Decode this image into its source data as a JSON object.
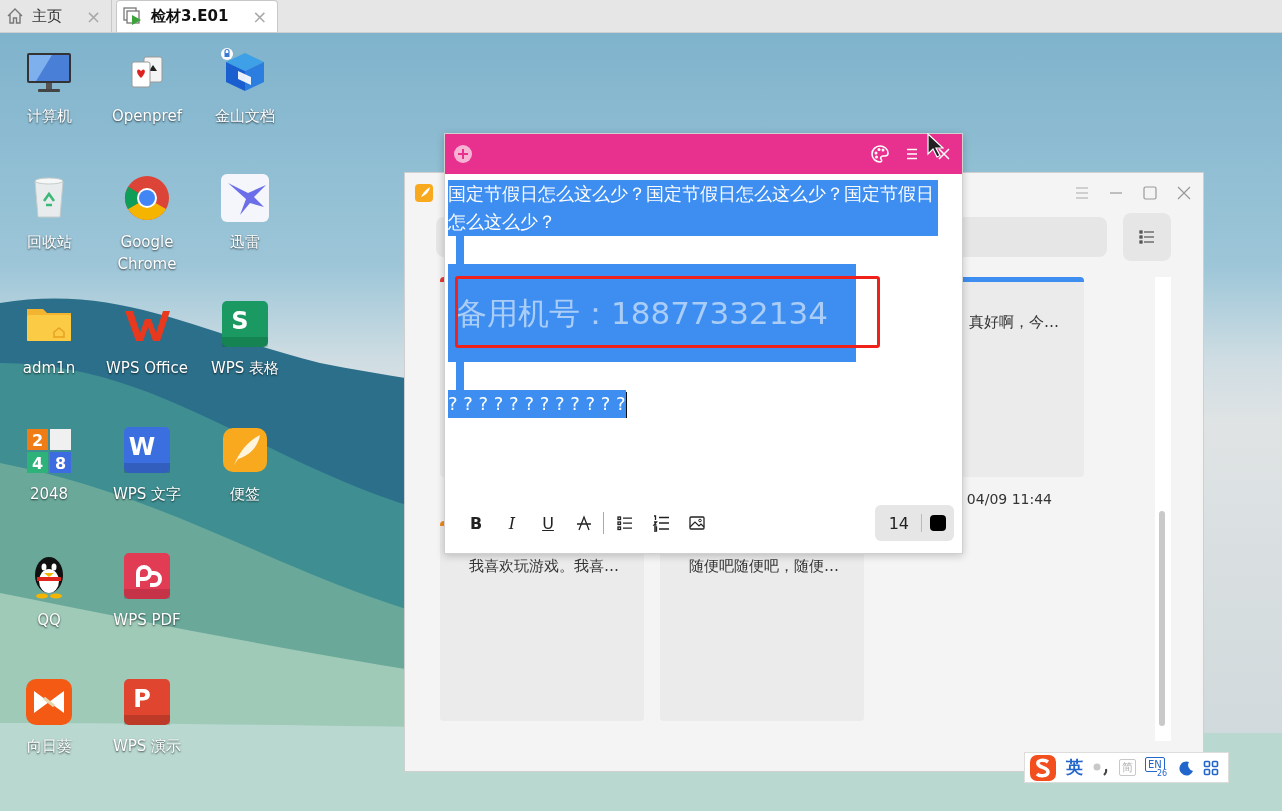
{
  "tabs": [
    {
      "label": "主页",
      "close": "×",
      "selected": false
    },
    {
      "label": "检材3.E01",
      "close": "×",
      "selected": true
    }
  ],
  "desktop_icons": [
    {
      "label": "计算机",
      "kind": "monitor"
    },
    {
      "label": "回收站",
      "kind": "trash"
    },
    {
      "label": "adm1n",
      "kind": "folder"
    },
    {
      "label": "2048",
      "kind": "game2048",
      "glyphs": [
        "2",
        "4",
        "8"
      ]
    },
    {
      "label": "QQ",
      "kind": "penguin"
    },
    {
      "label": "向日葵",
      "kind": "sunflower"
    },
    {
      "label": "Openpref",
      "kind": "cards"
    },
    {
      "label": "Google Chrome",
      "kind": "chrome"
    },
    {
      "label": "WPS Office",
      "kind": "wps"
    },
    {
      "label": "WPS 文字",
      "kind": "tile",
      "glyph": "W",
      "color": "#3b6fe0"
    },
    {
      "label": "WPS PDF",
      "kind": "pdf"
    },
    {
      "label": "WPS 演示",
      "kind": "tile",
      "glyph": "P",
      "color": "#e0452f"
    },
    {
      "label": "金山文档",
      "kind": "cube"
    },
    {
      "label": "迅雷",
      "kind": "bird"
    },
    {
      "label": "WPS 表格",
      "kind": "tile",
      "glyph": "S",
      "color": "#1a9a62"
    },
    {
      "label": "便签",
      "kind": "feather"
    }
  ],
  "notes_window": {
    "cards": [
      {
        "color": "#e53935"
      },
      {
        "color": "#3d8ef0",
        "text": "真好啊，今…",
        "date": "04/09 11:44"
      },
      {
        "color": "#f08a24",
        "text": "我喜欢玩游戏。我喜…"
      },
      {
        "text": "随便吧随便吧，随便…"
      }
    ]
  },
  "note_editor": {
    "paragraphs": [
      {
        "kind": "text",
        "text": "国定节假日怎么这么少？国定节假日怎么这么少？国定节假日怎么这么少？",
        "selected": true
      },
      {
        "kind": "blank",
        "selected": true
      },
      {
        "kind": "large",
        "text": "备用机号：18877332134",
        "selected": true
      },
      {
        "kind": "blank",
        "selected": true
      },
      {
        "kind": "text",
        "text": "? ? ? ? ? ? ? ? ? ? ? ?",
        "selected": true
      }
    ],
    "toolbar": [
      {
        "kind": "bold",
        "label": "B"
      },
      {
        "kind": "italic",
        "label": "I"
      },
      {
        "kind": "underline",
        "label": "U"
      },
      {
        "kind": "strikethrough"
      },
      {
        "kind": "separator"
      },
      {
        "kind": "bullet-list"
      },
      {
        "kind": "numbered-list"
      },
      {
        "kind": "image"
      }
    ],
    "font_size": "14",
    "text_color_swatch": {
      "color": "#000000"
    }
  },
  "ime_bar": {
    "mode": "英",
    "script": "简",
    "layout": "EN",
    "layout_number": "26"
  }
}
